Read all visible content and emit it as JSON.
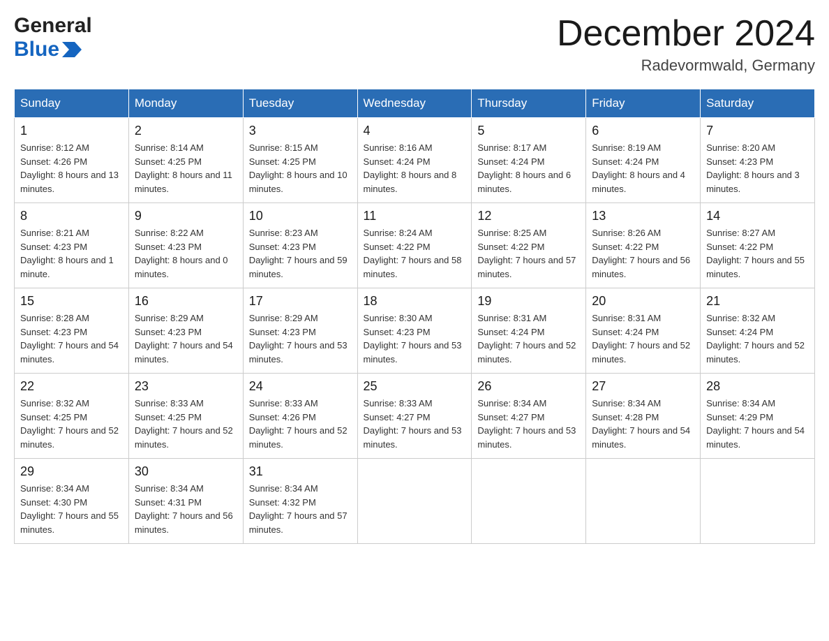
{
  "logo": {
    "line1": "General",
    "line2": "Blue"
  },
  "header": {
    "month": "December 2024",
    "location": "Radevormwald, Germany"
  },
  "days_of_week": [
    "Sunday",
    "Monday",
    "Tuesday",
    "Wednesday",
    "Thursday",
    "Friday",
    "Saturday"
  ],
  "weeks": [
    [
      {
        "day": "1",
        "sunrise": "8:12 AM",
        "sunset": "4:26 PM",
        "daylight": "8 hours and 13 minutes."
      },
      {
        "day": "2",
        "sunrise": "8:14 AM",
        "sunset": "4:25 PM",
        "daylight": "8 hours and 11 minutes."
      },
      {
        "day": "3",
        "sunrise": "8:15 AM",
        "sunset": "4:25 PM",
        "daylight": "8 hours and 10 minutes."
      },
      {
        "day": "4",
        "sunrise": "8:16 AM",
        "sunset": "4:24 PM",
        "daylight": "8 hours and 8 minutes."
      },
      {
        "day": "5",
        "sunrise": "8:17 AM",
        "sunset": "4:24 PM",
        "daylight": "8 hours and 6 minutes."
      },
      {
        "day": "6",
        "sunrise": "8:19 AM",
        "sunset": "4:24 PM",
        "daylight": "8 hours and 4 minutes."
      },
      {
        "day": "7",
        "sunrise": "8:20 AM",
        "sunset": "4:23 PM",
        "daylight": "8 hours and 3 minutes."
      }
    ],
    [
      {
        "day": "8",
        "sunrise": "8:21 AM",
        "sunset": "4:23 PM",
        "daylight": "8 hours and 1 minute."
      },
      {
        "day": "9",
        "sunrise": "8:22 AM",
        "sunset": "4:23 PM",
        "daylight": "8 hours and 0 minutes."
      },
      {
        "day": "10",
        "sunrise": "8:23 AM",
        "sunset": "4:23 PM",
        "daylight": "7 hours and 59 minutes."
      },
      {
        "day": "11",
        "sunrise": "8:24 AM",
        "sunset": "4:22 PM",
        "daylight": "7 hours and 58 minutes."
      },
      {
        "day": "12",
        "sunrise": "8:25 AM",
        "sunset": "4:22 PM",
        "daylight": "7 hours and 57 minutes."
      },
      {
        "day": "13",
        "sunrise": "8:26 AM",
        "sunset": "4:22 PM",
        "daylight": "7 hours and 56 minutes."
      },
      {
        "day": "14",
        "sunrise": "8:27 AM",
        "sunset": "4:22 PM",
        "daylight": "7 hours and 55 minutes."
      }
    ],
    [
      {
        "day": "15",
        "sunrise": "8:28 AM",
        "sunset": "4:23 PM",
        "daylight": "7 hours and 54 minutes."
      },
      {
        "day": "16",
        "sunrise": "8:29 AM",
        "sunset": "4:23 PM",
        "daylight": "7 hours and 54 minutes."
      },
      {
        "day": "17",
        "sunrise": "8:29 AM",
        "sunset": "4:23 PM",
        "daylight": "7 hours and 53 minutes."
      },
      {
        "day": "18",
        "sunrise": "8:30 AM",
        "sunset": "4:23 PM",
        "daylight": "7 hours and 53 minutes."
      },
      {
        "day": "19",
        "sunrise": "8:31 AM",
        "sunset": "4:24 PM",
        "daylight": "7 hours and 52 minutes."
      },
      {
        "day": "20",
        "sunrise": "8:31 AM",
        "sunset": "4:24 PM",
        "daylight": "7 hours and 52 minutes."
      },
      {
        "day": "21",
        "sunrise": "8:32 AM",
        "sunset": "4:24 PM",
        "daylight": "7 hours and 52 minutes."
      }
    ],
    [
      {
        "day": "22",
        "sunrise": "8:32 AM",
        "sunset": "4:25 PM",
        "daylight": "7 hours and 52 minutes."
      },
      {
        "day": "23",
        "sunrise": "8:33 AM",
        "sunset": "4:25 PM",
        "daylight": "7 hours and 52 minutes."
      },
      {
        "day": "24",
        "sunrise": "8:33 AM",
        "sunset": "4:26 PM",
        "daylight": "7 hours and 52 minutes."
      },
      {
        "day": "25",
        "sunrise": "8:33 AM",
        "sunset": "4:27 PM",
        "daylight": "7 hours and 53 minutes."
      },
      {
        "day": "26",
        "sunrise": "8:34 AM",
        "sunset": "4:27 PM",
        "daylight": "7 hours and 53 minutes."
      },
      {
        "day": "27",
        "sunrise": "8:34 AM",
        "sunset": "4:28 PM",
        "daylight": "7 hours and 54 minutes."
      },
      {
        "day": "28",
        "sunrise": "8:34 AM",
        "sunset": "4:29 PM",
        "daylight": "7 hours and 54 minutes."
      }
    ],
    [
      {
        "day": "29",
        "sunrise": "8:34 AM",
        "sunset": "4:30 PM",
        "daylight": "7 hours and 55 minutes."
      },
      {
        "day": "30",
        "sunrise": "8:34 AM",
        "sunset": "4:31 PM",
        "daylight": "7 hours and 56 minutes."
      },
      {
        "day": "31",
        "sunrise": "8:34 AM",
        "sunset": "4:32 PM",
        "daylight": "7 hours and 57 minutes."
      },
      null,
      null,
      null,
      null
    ]
  ],
  "labels": {
    "sunrise": "Sunrise:",
    "sunset": "Sunset:",
    "daylight": "Daylight:"
  }
}
